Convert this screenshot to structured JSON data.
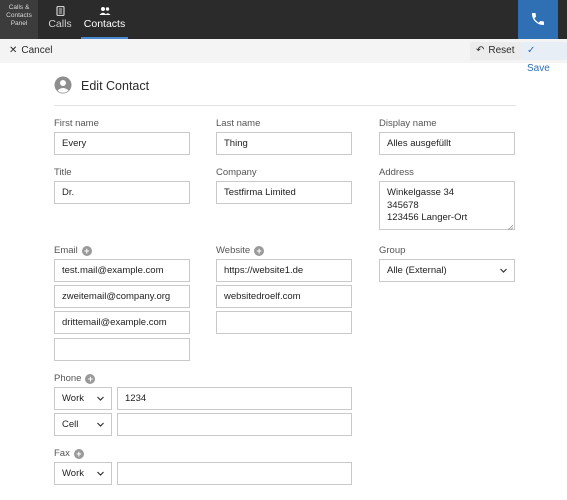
{
  "app": {
    "brand_lines": [
      "Calls &",
      "Contacts",
      "Panel"
    ]
  },
  "nav": {
    "calls": {
      "label": "Calls",
      "icon": "phone-list-icon"
    },
    "contacts": {
      "label": "Contacts",
      "icon": "people-icon",
      "active": true
    },
    "phone_button_icon": "phone-icon"
  },
  "toolbar": {
    "cancel_label": "Cancel",
    "reset_label": "Reset",
    "save_label": "Save"
  },
  "heading": {
    "title": "Edit Contact",
    "icon": "person-circle-icon"
  },
  "form": {
    "first_name": {
      "label": "First name",
      "value": "Every"
    },
    "last_name": {
      "label": "Last name",
      "value": "Thing"
    },
    "display_name": {
      "label": "Display name",
      "value": "Alles ausgefüllt"
    },
    "title": {
      "label": "Title",
      "value": "Dr."
    },
    "company": {
      "label": "Company",
      "value": "Testfirma Limited"
    },
    "address": {
      "label": "Address",
      "lines": [
        "Winkelgasse 34",
        "345678",
        "123456 Langer-Ort"
      ]
    },
    "email": {
      "label": "Email",
      "values": [
        "test.mail@example.com",
        "zweitemail@company.org",
        "drittemail@example.com",
        ""
      ]
    },
    "website": {
      "label": "Website",
      "values": [
        "https://website1.de",
        "websitedroelf.com",
        ""
      ]
    },
    "group": {
      "label": "Group",
      "value": "Alle (External)"
    },
    "phone": {
      "label": "Phone",
      "rows": [
        {
          "type": "Work",
          "number": "1234"
        },
        {
          "type": "Cell",
          "number": ""
        }
      ]
    },
    "fax": {
      "label": "Fax",
      "rows": [
        {
          "type": "Work",
          "number": ""
        }
      ]
    }
  },
  "colors": {
    "topbar": "#2b2b2b",
    "accent": "#2f6fb4",
    "active_tab_underline": "#4a8bd2"
  }
}
